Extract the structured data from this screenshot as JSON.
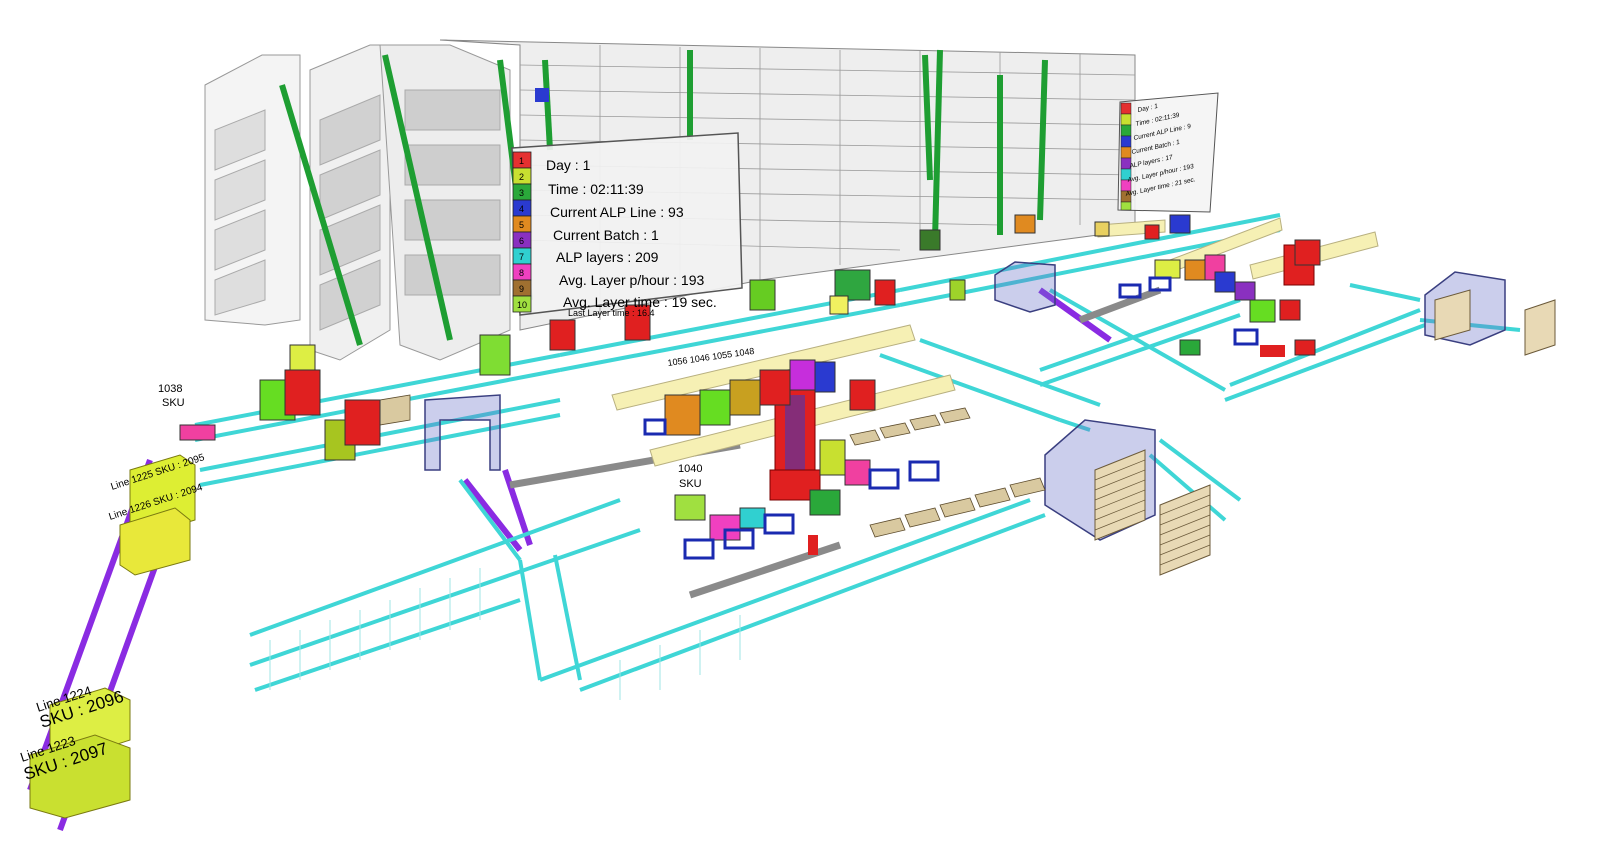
{
  "panel_main": {
    "numbers": [
      "1",
      "2",
      "3",
      "4",
      "5",
      "6",
      "7",
      "8",
      "9",
      "10"
    ],
    "lines": [
      "Day : 1",
      "Time : 02:11:39",
      "Current ALP Line : 93",
      "Current Batch : 1",
      "ALP layers : 209",
      "Avg. Layer p/hour : 193",
      "Avg. Layer time : 19 sec."
    ],
    "footer": "Last Layer time : 16.4"
  },
  "panel_small": {
    "lines": [
      "Day : 1",
      "Time : 02:11:39",
      "Current ALP Line : 9",
      "Current Batch : 1",
      "ALP layers : 17",
      "Avg. Layer p/hour : 193",
      "Avg. Layer time : 21 sec."
    ]
  },
  "labels": {
    "sku_1038_num": "1038",
    "sku_1038_word": "SKU",
    "sku_1040_num": "1040",
    "sku_1040_word": "SKU",
    "line_1224": "Line 1224",
    "sku_2096": "SKU : 2096",
    "line_1223": "Line 1223",
    "sku_2097": "SKU : 2097",
    "stack_a": "Line 1225 SKU : 2095",
    "stack_b": "Line 1226 SKU : 2094",
    "line_numbers": "1056  1046  1055  1048"
  },
  "colors": {
    "conveyor": "#3fd6d6",
    "purple_track": "#8a2be2",
    "rack_green": "#1e9e32",
    "beam_yellow": "#f6f0b4",
    "crane_red": "#e02020",
    "panel_bg": "#f2f2f2"
  },
  "legend_colors": [
    "#e53030",
    "#c8e030",
    "#2aa83a",
    "#2a3ad0",
    "#e08a20",
    "#8a30c0",
    "#30d0d0",
    "#f040c0",
    "#a07030",
    "#a0e040"
  ]
}
